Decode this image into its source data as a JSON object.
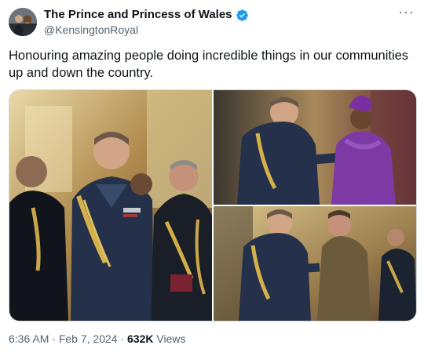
{
  "author": {
    "display_name": "The Prince and Princess of Wales",
    "handle": "@KensingtonRoyal",
    "verified_color": "#1d9bf0"
  },
  "more_icon": "more-horizontal-icon",
  "tweet": {
    "text": "Honouring amazing people doing incredible things in our communities up and down the country."
  },
  "media": [
    {
      "description": "Prince William in RAF uniform at investiture in palace hall"
    },
    {
      "description": "Prince William pinning honour on woman in purple"
    },
    {
      "description": "Prince William presenting honour to soldier in khaki"
    }
  ],
  "meta": {
    "time": "6:36 AM",
    "separator": "·",
    "date": "Feb 7, 2024",
    "views_count": "632K",
    "views_label": "Views"
  },
  "colors": {
    "text_primary": "#0f1419",
    "text_secondary": "#536471",
    "border": "#cfd9de"
  }
}
